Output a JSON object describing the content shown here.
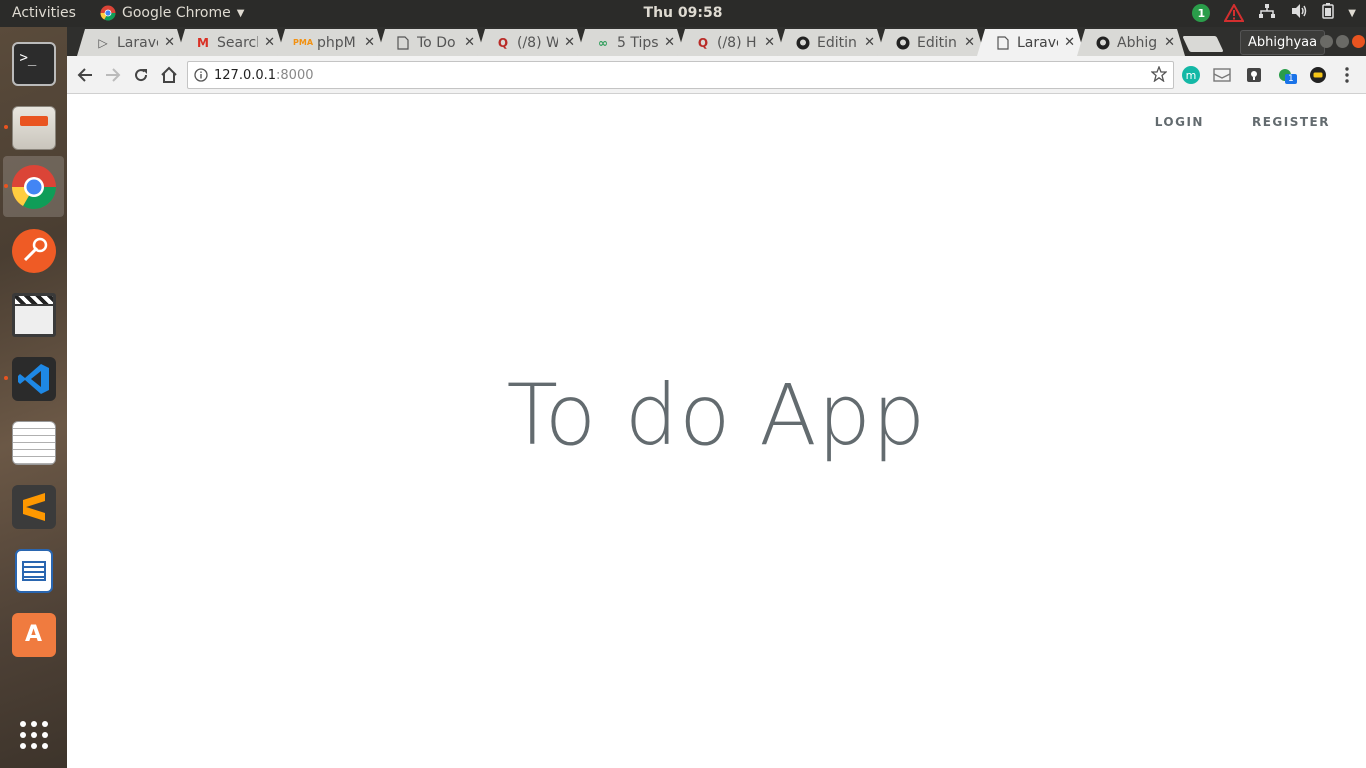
{
  "topbar": {
    "activities": "Activities",
    "app_name": "Google Chrome",
    "clock": "Thu 09:58",
    "notification_count": "1"
  },
  "dock": {
    "items": [
      "terminal",
      "files",
      "chrome",
      "postman",
      "video-editor",
      "vscode",
      "text-editor",
      "sublime-text",
      "libreoffice-writer",
      "software-center",
      "show-applications"
    ]
  },
  "tabs": [
    {
      "title": "Larave",
      "icon": "arrow-icon"
    },
    {
      "title": "Search",
      "icon": "gmail-icon"
    },
    {
      "title": "phpM",
      "icon": "pma-icon"
    },
    {
      "title": "To Do",
      "icon": "page-icon"
    },
    {
      "title": "(/8) W",
      "icon": "quora-icon"
    },
    {
      "title": "5 Tips",
      "icon": "link-icon"
    },
    {
      "title": "(/8) H",
      "icon": "quora-icon"
    },
    {
      "title": "Editin",
      "icon": "github-icon"
    },
    {
      "title": "Editin",
      "icon": "github-icon"
    },
    {
      "title": "Larave",
      "icon": "page-icon"
    },
    {
      "title": "Abhig",
      "icon": "github-icon"
    }
  ],
  "active_tab_index": 9,
  "profile_name": "Abhighyaa",
  "omnibox": {
    "host": "127.0.0.1",
    "port": ":8000"
  },
  "extension_badge": "1",
  "page": {
    "nav": {
      "login": "LOGIN",
      "register": "REGISTER"
    },
    "title": "To do App"
  },
  "colors": {
    "ubuntu_orange": "#e95420",
    "page_text": "#636b6f",
    "topbar": "#2b2b29"
  }
}
